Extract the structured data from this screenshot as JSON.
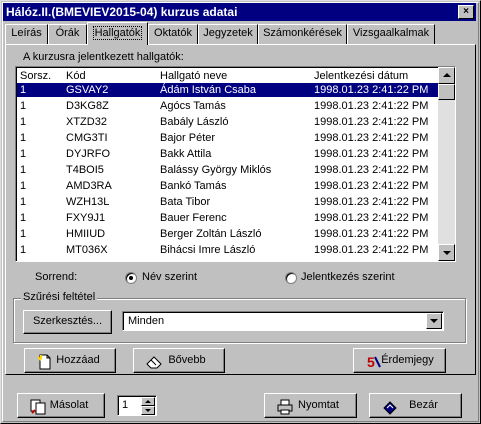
{
  "window": {
    "title": "Hálóz.II.(BMEVIEV2015-04) kurzus adatai",
    "close_glyph": "×"
  },
  "tabs": [
    "Leírás",
    "Órák",
    "Hallgatók",
    "Oktatók",
    "Jegyzetek",
    "Számonkérések",
    "Vizsgaalkalmak"
  ],
  "active_tab": "Hallgatók",
  "list": {
    "caption": "A kurzusra jelentkezett hallgatók:",
    "headers": [
      "Sorsz.",
      "Kód",
      "Hallgató neve",
      "Jelentkezési dátum"
    ],
    "rows": [
      [
        "1",
        "GSVAY2",
        "Ádám István Csaba",
        "1998.01.23 2:41:22 PM"
      ],
      [
        "1",
        "D3KG8Z",
        "Agócs Tamás",
        "1998.01.23 2:41:22 PM"
      ],
      [
        "1",
        "XTZD32",
        "Babály László",
        "1998.01.23 2:41:22 PM"
      ],
      [
        "1",
        "CMG3TI",
        "Bajor Péter",
        "1998.01.23 2:41:22 PM"
      ],
      [
        "1",
        "DYJRFO",
        "Bakk Attila",
        "1998.01.23 2:41:22 PM"
      ],
      [
        "1",
        "T4BOI5",
        "Balássy György Miklós",
        "1998.01.23 2:41:22 PM"
      ],
      [
        "1",
        "AMD3RA",
        "Bankó Tamás",
        "1998.01.23 2:41:22 PM"
      ],
      [
        "1",
        "WZH13L",
        "Bata Tibor",
        "1998.01.23 2:41:22 PM"
      ],
      [
        "1",
        "FXY9J1",
        "Bauer Ferenc",
        "1998.01.23 2:41:22 PM"
      ],
      [
        "1",
        "HMIIUD",
        "Berger Zoltán László",
        "1998.01.23 2:41:22 PM"
      ],
      [
        "1",
        "MT036X",
        "Bihácsi Imre László",
        "1998.01.23 2:41:22 PM"
      ]
    ],
    "selected_index": 0
  },
  "sort": {
    "label": "Sorrend:",
    "options": [
      "Név szerint",
      "Jelentkezés szerint"
    ],
    "selected": "Név szerint"
  },
  "filter": {
    "group_label": "Szűrési feltétel",
    "edit_button": "Szerkesztés...",
    "combo_value": "Minden"
  },
  "actions": {
    "add": "Hozzáad",
    "more": "Bővebb",
    "grade": "Érdemjegy"
  },
  "footer": {
    "copy": "Másolat",
    "copies": "1",
    "print": "Nyomtat",
    "close": "Bezár"
  },
  "colors": {
    "selection": "#000080",
    "face": "#c0c0c0",
    "title_bar": "#000080"
  }
}
